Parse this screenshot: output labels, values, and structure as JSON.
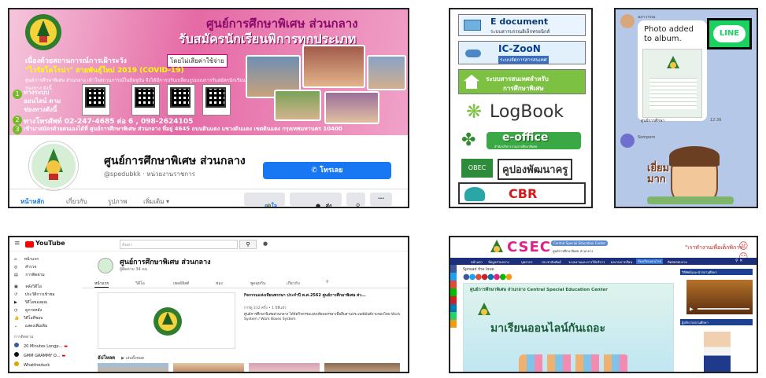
{
  "facebook": {
    "banner_title_1": "ศูนย์การศึกษาพิเศษ ส่วนกลาง",
    "banner_title_2": "รับสมัครนักเรียนพิการทุกประเภท",
    "banner_line_1": "เนื่องด้วยสถานการณ์การเฝ้าระวัง",
    "banner_tag": "โดยไม่เสียค่าใช้จ่าย",
    "banner_line_2": "\"ไวรัสโคโรน่า\" สายพันธุ์ใหม่ 2019 (COVID-19)",
    "banner_note": "ศูนย์การศึกษาพิเศษ ส่วนกลาง เข้าใจสถานการณ์ในปัจจุบัน จึงได้มีการปรับเปลี่ยนรูปแบบการรับสมัครนักเรียน โดยมีช่องทาง ดังนี้",
    "option_1_num": "1",
    "option_1": "ทางระบบออนไลน์ ตามช่องทางดังนี้",
    "option_2_num": "2",
    "option_2": "ทางโทรศัพท์ 02-247-4685 ต่อ 6 , 098-2624105",
    "option_3_num": "3",
    "option_3": "เข้ามาสมัครด้วยตนเองได้ที่ ศูนย์การศึกษาพิเศษ ส่วนกลาง ที่อยู่ 4645 ถนนดินแดง แขวงดินแดง เขตดินแดง กรุงเทพมหานคร 10400",
    "page_name": "ศูนย์การศึกษาพิเศษ ส่วนกลาง",
    "page_sub": "@spedubkk · หน่วยงานราชการ",
    "call_button": "โทรเลย",
    "nav": [
      "หน้าหลัก",
      "เกี่ยวกับ",
      "รูปภาพ",
      "เพิ่มเติม ▾"
    ],
    "like_button": "ถูกใจ",
    "message_button": "ส่งข้อความ",
    "search_icon": "search-icon",
    "more_label": "···"
  },
  "links": {
    "edoc_title": "E document",
    "edoc_sub": "ระบบสารบรรณอิเล็กทรอนิกส์",
    "iczoon_title": "IC-ZooN",
    "iczoon_sub": "ระบบจัดการสารสนเทศ",
    "ems_title": "ระบบสารสนเทศสำหรับ",
    "ems_sub": "การศึกษาพิเศษ",
    "logbook": "LogBook",
    "eoffice": "e-office",
    "eoffice_sub": "สำนักบริหารงานการศึกษาพิเศษ",
    "obec": "OBEC",
    "coupon": "คูปองพัฒนาครู",
    "cbr": "CBR"
  },
  "line": {
    "sender": "นภาวรรณ",
    "bubble": "Photo added to album.",
    "logo": "LINE",
    "time_label": "12:36",
    "album_label": "ศูนย์การศึกษา",
    "sender2": "Somporn",
    "sticker_text": "เยี่ยมมาก"
  },
  "youtube": {
    "brand": "YouTube",
    "search_placeholder": "ค้นหา",
    "sidebar": [
      "หน้าแรก",
      "สำรวจ",
      "การติดตาม",
      "คลังวิดีโอ",
      "ประวัติการเข้าชม",
      "วิดีโอของคุณ",
      "ดูภายหลัง",
      "วิดีโอที่ชอบ",
      "แสดงเพิ่มเติม"
    ],
    "subs_heading": "การติดตาม",
    "subs": [
      "20 Minutes Longp...",
      "GMM GRAMMY O...",
      "Whattheduck"
    ],
    "channel_name": "ศูนย์การศึกษาพิเศษ ส่วนกลาง",
    "channel_subs": "ผู้ติดตาม 34 คน",
    "tabs": [
      "หน้าแรก",
      "วิดีโอ",
      "เพลย์ลิสต์",
      "ช่อง",
      "พูดคุยกัน",
      "เกี่ยวกับ"
    ],
    "video_title": "กิจกรรมแห่งเทียนพรรษา ประจำปี พ.ศ.2562 ศูนย์การศึกษาพิเศษ ส่ว...",
    "video_meta": "การดู 232 ครั้ง • 1 ปีที่แล้ว",
    "video_desc": "ศูนย์การศึกษาพิเศษส่วนกลาง ได้จัดกิจกรรมแห่งเทียนพรรษาเพื่อสืบสานประเพณีอันดีงามของไทย Work System / Work Boxes System",
    "uploads_label": "อัปโหลด",
    "play_all": "เล่นทั้งหมด"
  },
  "csec": {
    "brand": "CSEC",
    "brand_badge": "Central Special Education Center",
    "brand_sub": "ศูนย์การศึกษาพิเศษ ส่วนกลาง",
    "slogan": "\"เราทำงานเพื่อเด็กพิการ\"",
    "nav": [
      "หน้าแรก",
      "ข้อมูลส่วนกลาง",
      "บุคลากร",
      "ประชาสัมพันธ์",
      "ระบบงานและการให้บริการ",
      "ผลงานการเรียน",
      "ห้องเรียนออนไลน์",
      "ติดต่อสอบถาม"
    ],
    "spread": "Spread the love",
    "hero_title": "ศูนย์การศึกษาพิเศษ ส่วนกลาง Central Special Education Center",
    "hero_text": "มาเรียนออนไลน์กันเถอะ",
    "side_heading_1": "วิดีทัศน์แนะนำสถานศึกษา",
    "side_heading_2": "ผู้บริหารสถานศึกษา"
  }
}
